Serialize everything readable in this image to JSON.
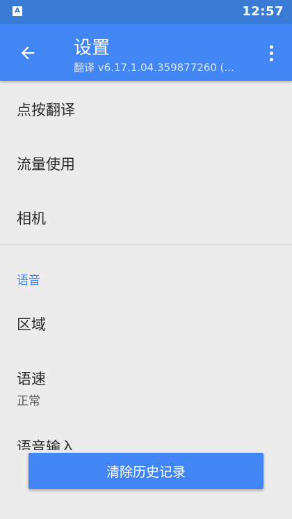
{
  "status_bar": {
    "app_icon_letter": "A",
    "time": "12:57"
  },
  "app_bar": {
    "title": "设置",
    "subtitle": "翻译 v6.17.1.04.359877260 (..."
  },
  "settings": {
    "items": [
      {
        "label": "点按翻译"
      },
      {
        "label": "流量使用"
      },
      {
        "label": "相机"
      }
    ],
    "voice_section": {
      "header": "语音",
      "items": [
        {
          "label": "区域"
        },
        {
          "label": "语速",
          "value": "正常"
        },
        {
          "label": "语音输入"
        }
      ]
    }
  },
  "actions": {
    "clear_history": "清除历史记录"
  },
  "colors": {
    "status_bar": "#3a7bd5",
    "app_bar": "#4285f4",
    "accent": "#4285f4",
    "background": "#ececec"
  }
}
